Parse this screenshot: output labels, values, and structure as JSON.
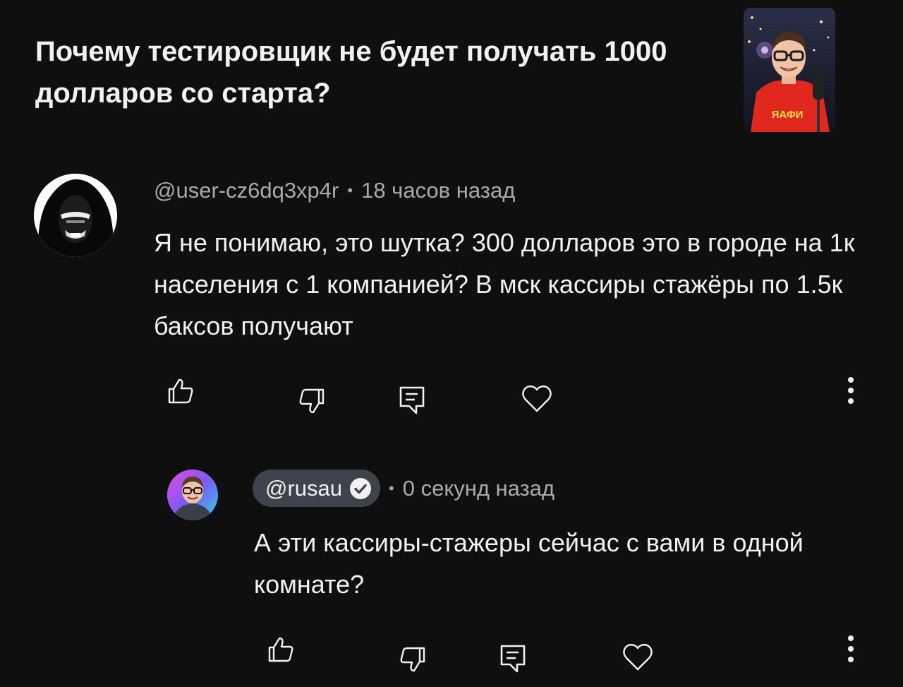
{
  "video": {
    "title": "Почему тестировщик не будет получать 1000 долларов со старта?",
    "thumbnail_shirt_text": "ЯАФИ"
  },
  "comments": [
    {
      "author": "@user-cz6dq3xp4r",
      "time": "18 часов назад",
      "text": "Я не понимаю, это шутка? 300 долларов это в городе на 1к населения с 1 компанией? В мск кассиры стажёры по 1.5к баксов получают",
      "icons": [
        "like-icon",
        "dislike-icon",
        "reply-icon",
        "heart-icon",
        "more-vert-icon"
      ]
    },
    {
      "author": "@rusau",
      "verified": true,
      "is_channel_owner": true,
      "time": "0 секунд назад",
      "text": "А эти кассиры-стажеры сейчас с вами в одной комнате?",
      "icons": [
        "like-icon",
        "dislike-icon",
        "reply-icon",
        "heart-icon",
        "more-vert-icon"
      ]
    }
  ],
  "separator": "•",
  "colors": {
    "background": "#0f0f0f",
    "text_primary": "#f1f1f1",
    "text_secondary": "#aaaaaa",
    "owner_chip": "#3f434c"
  }
}
